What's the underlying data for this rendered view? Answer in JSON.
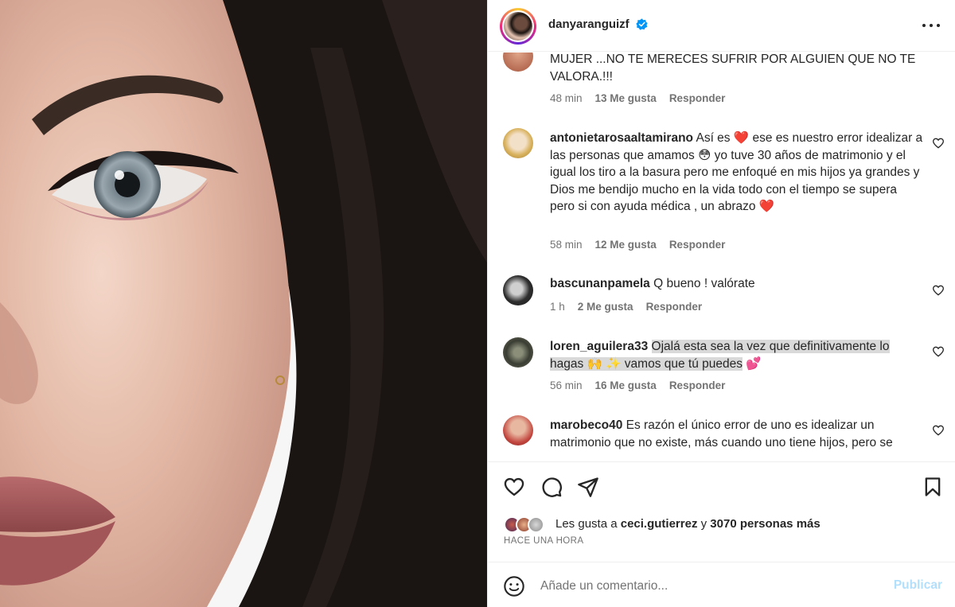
{
  "post": {
    "username": "danyaranguizf",
    "verified_icon": "verified-badge-icon",
    "more_icon": "more-options-icon"
  },
  "comments": [
    {
      "text": "MUJER ...NO TE MERECES SUFRIR POR ALGUIEN QUE NO TE VALORA.!!!",
      "time": "48 min",
      "likes": "13 Me gusta",
      "reply": "Responder"
    },
    {
      "user": "antonietarosaaltamirano",
      "text_1": " Así es ",
      "emoji_heart": "❤️",
      "text_2": " ese es nuestro error idealizar a las personas que amamos ",
      "emoji_face": "😳",
      "text_3": " yo tuve 30 años de matrimonio y el igual los tiro a la basura pero me enfoqué en mis hijos ya grandes y Dios me bendijo mucho en la vida todo con el tiempo se supera pero si con ayuda médica , un abrazo ",
      "emoji_heart_end": "❤️",
      "time": "58 min",
      "likes": "12 Me gusta",
      "reply": "Responder"
    },
    {
      "user": "bascunanpamela",
      "text": " Q bueno ! valórate",
      "time": "1 h",
      "likes": "2 Me gusta",
      "reply": "Responder"
    },
    {
      "user": "loren_aguilera33",
      "text_1": "Ojalá esta sea la vez que definitivamente lo hagas ",
      "emoji_1": "🙌",
      "emoji_2": "✨",
      "text_2": " vamos que tú puedes",
      "emoji_3": "💕",
      "time": "56 min",
      "likes": "16 Me gusta",
      "reply": "Responder"
    },
    {
      "user": "marobeco40",
      "text": " Es razón el único error de uno es idealizar un matrimonio que no existe, más cuando uno tiene hijos, pero se"
    }
  ],
  "actions": {
    "like_icon": "heart-icon",
    "comment_icon": "comment-icon",
    "share_icon": "share-icon",
    "save_icon": "bookmark-icon"
  },
  "likes": {
    "prefix": "Les gusta a ",
    "user": "ceci.gutierrez",
    "middle": " y ",
    "others": "3070 personas más"
  },
  "timestamp": "HACE UNA HORA",
  "composer": {
    "placeholder": "Añade un comentario...",
    "publish_label": "Publicar",
    "emoji_icon": "emoji-icon"
  }
}
